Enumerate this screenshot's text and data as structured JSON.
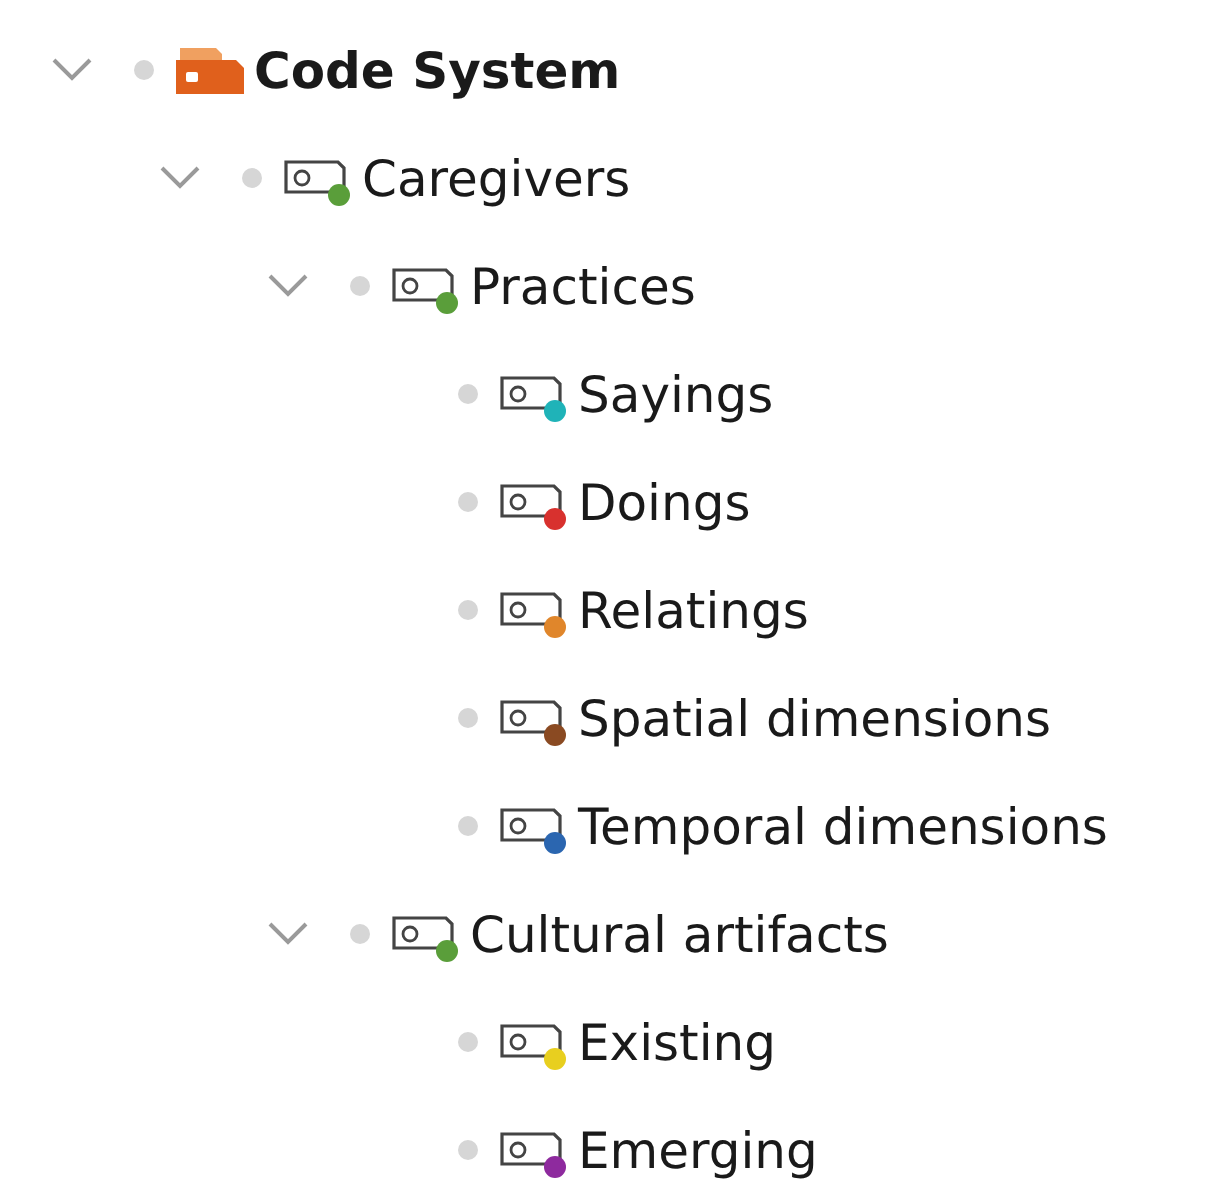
{
  "code_tree": [
    {
      "label": "Code System",
      "kind": "root",
      "expanded": true,
      "children": [
        {
          "label": "Caregivers",
          "kind": "code",
          "color": "#5a9e3a",
          "expanded": true,
          "children": [
            {
              "label": "Practices",
              "kind": "code",
              "color": "#5a9e3a",
              "expanded": true,
              "children": [
                {
                  "label": "Sayings",
                  "kind": "code",
                  "color": "#1fb3b8"
                },
                {
                  "label": "Doings",
                  "kind": "code",
                  "color": "#d8312e"
                },
                {
                  "label": "Relatings",
                  "kind": "code",
                  "color": "#e0862b"
                },
                {
                  "label": "Spatial dimensions",
                  "kind": "code",
                  "color": "#8a4a22"
                },
                {
                  "label": "Temporal dimensions",
                  "kind": "code",
                  "color": "#2b66b0"
                }
              ]
            },
            {
              "label": "Cultural artifacts",
              "kind": "code",
              "color": "#5a9e3a",
              "expanded": true,
              "children": [
                {
                  "label": "Existing",
                  "kind": "code",
                  "color": "#e8cf1f"
                },
                {
                  "label": "Emerging",
                  "kind": "code",
                  "color": "#8e2a9e"
                }
              ]
            }
          ]
        }
      ]
    }
  ]
}
